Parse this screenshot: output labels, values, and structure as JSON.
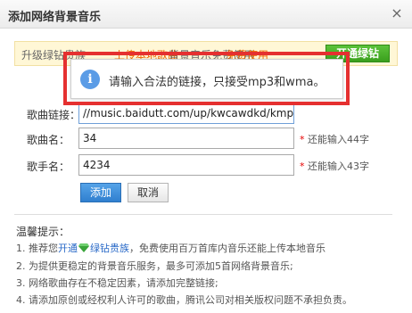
{
  "dialog": {
    "title": "添加网络背景音乐",
    "close_glyph": "×"
  },
  "promo": {
    "text_prefix": "升级绿钻贵族",
    "upload_link": "上传本地歌曲",
    "text_mid": "背景音乐免费使用",
    "free_link": "免费使用",
    "open_button": "开通绿钻"
  },
  "tooltip": {
    "icon_glyph": "i",
    "message": "请输入合法的链接，只接受mp3和wma。"
  },
  "form": {
    "url_label": "歌曲链接：",
    "url_value": "//music.baidutt.com/up/kwcawdkd/kmpsu",
    "song_label": "歌曲名：",
    "song_value": "34",
    "song_hint": "还能输入44字",
    "singer_label": "歌手名：",
    "singer_value": "4234",
    "singer_hint": "还能输入43字",
    "required_mark": "*"
  },
  "buttons": {
    "add": "添加",
    "cancel": "取消"
  },
  "tips": {
    "title": "温馨提示：",
    "item1_prefix": "1. 推荐您",
    "item1_link1": "开通",
    "item1_link2": "绿钻贵族",
    "item1_suffix": "，免费使用百万首库内音乐还能上传本地音乐",
    "item2": "2. 为提供更稳定的背景音乐服务，最多可添加5首网络背景音乐;",
    "item3": "3. 网络歌曲存在不稳定因素，请添加完整链接;",
    "item4": "4. 请添加原创或经权利人许可的歌曲，腾讯公司对相关版权问题不承担负责。"
  },
  "colors": {
    "highlight_frame": "#e53030",
    "info_icon": "#5b9ce6",
    "add_button": "#2f7fcf",
    "open_button": "#3a9f1d",
    "link": "#2a6ac8",
    "promo_link": "#ee6600"
  }
}
